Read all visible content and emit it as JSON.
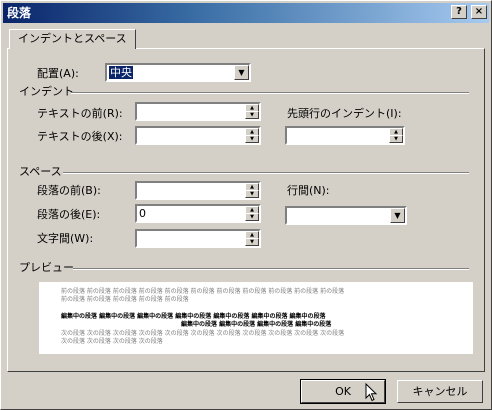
{
  "window": {
    "title": "段落",
    "help_glyph": "?",
    "close_glyph": "×"
  },
  "tab": {
    "label": "インデントとスペース"
  },
  "alignment": {
    "label": "配置(A):",
    "value": "中央"
  },
  "indent": {
    "section": "インデント",
    "before_label": "テキストの前(R):",
    "before_value": "",
    "after_label": "テキストの後(X):",
    "after_value": "",
    "first_line_label": "先頭行のインデント(I):",
    "first_line_value": ""
  },
  "spacing": {
    "section": "スペース",
    "before_label": "段落の前(B):",
    "before_value": "",
    "after_label": "段落の後(E):",
    "after_value": "0",
    "char_label": "文字間(W):",
    "char_value": "",
    "line_label": "行間(N):",
    "line_value": ""
  },
  "preview": {
    "section": "プレビュー",
    "prev_line1": "前の段落 前の段落 前の段落 前の段落 前の段落 前の段落 前の段落 前の段落 前の段落 前の段落 前の段落",
    "prev_line2": "前の段落 前の段落 前の段落 前の段落 前の段落",
    "cur_line1": "編集中の段落 編集中の段落 編集中の段落 編集中の段落 編集中の段落 編集中の段落 編集中の段落",
    "cur_line2": "編集中の段落 編集中の段落 編集中の段落 編集中の段落",
    "next_line1": "次の段落 次の段落 次の段落 次の段落 次の段落 次の段落 次の段落 次の段落 次の段落 次の段落 次の段落",
    "next_line2": "次の段落 次の段落 次の段落 次の段落"
  },
  "buttons": {
    "ok": "OK",
    "cancel": "キャンセル"
  }
}
